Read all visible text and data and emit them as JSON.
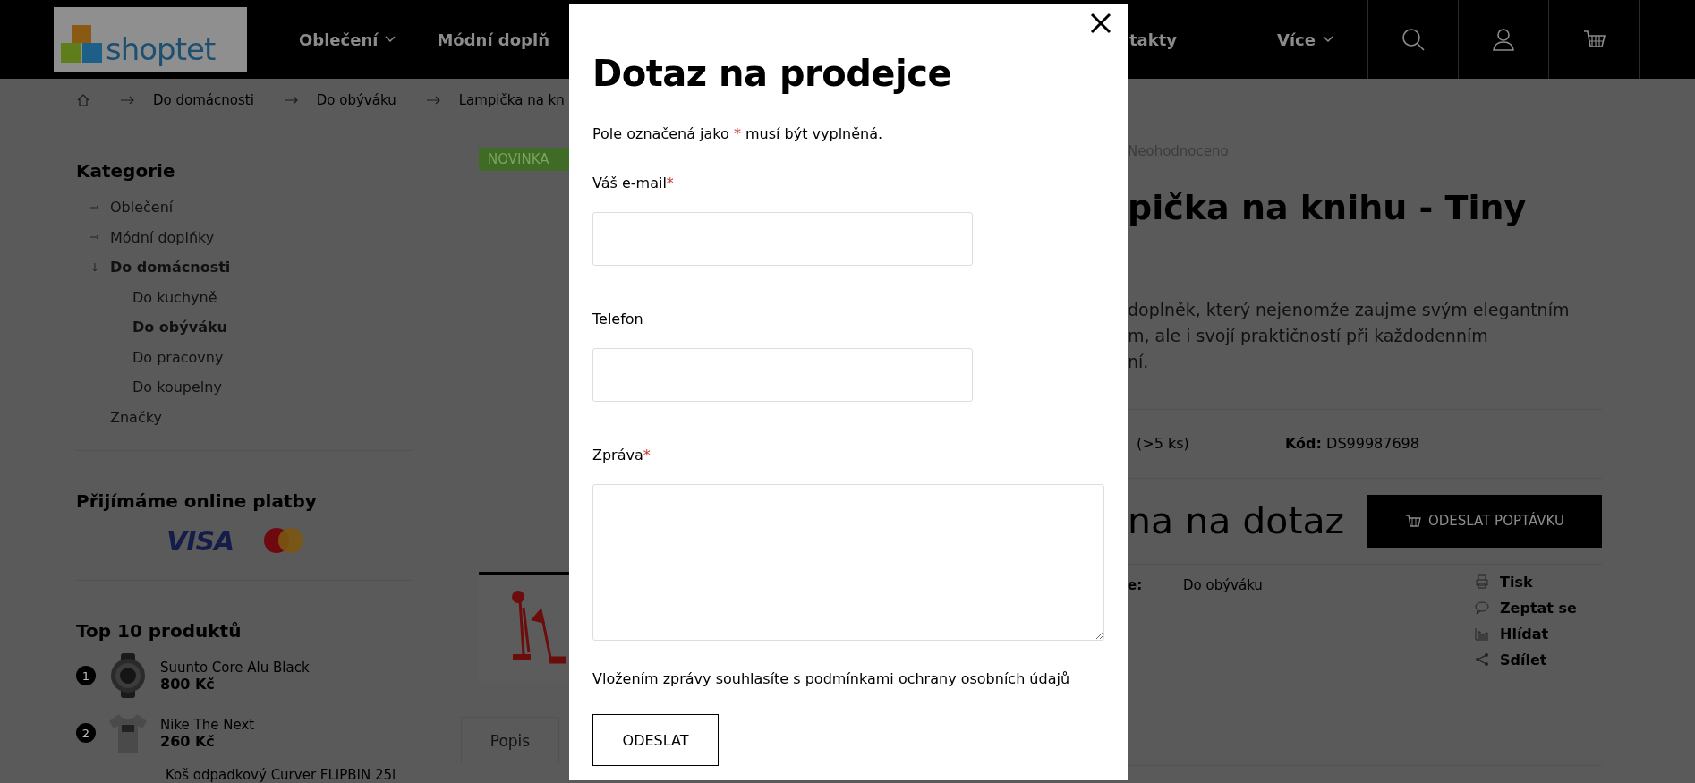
{
  "header": {
    "logo": "shoptet",
    "nav": [
      {
        "label": "Oblečení",
        "dropdown": true
      },
      {
        "label": "Módní doplň",
        "dropdown": false
      }
    ],
    "nav_right": [
      {
        "label": "takty",
        "dropdown": false
      },
      {
        "label": "Více",
        "dropdown": true
      }
    ]
  },
  "breadcrumb": [
    "Do domácnosti",
    "Do obýváku",
    "Lampička na kn"
  ],
  "sidebar": {
    "categories_title": "Kategorie",
    "categories": [
      {
        "label": "Oblečení",
        "kind": "branch",
        "expanded": false,
        "active": false
      },
      {
        "label": "Módní doplňky",
        "kind": "branch",
        "expanded": false,
        "active": false
      },
      {
        "label": "Do domácnosti",
        "kind": "branch",
        "expanded": true,
        "active": true,
        "children": [
          {
            "label": "Do kuchyně",
            "active": false
          },
          {
            "label": "Do obýváku",
            "active": true
          },
          {
            "label": "Do pracovny",
            "active": false
          },
          {
            "label": "Do koupelny",
            "active": false
          }
        ]
      },
      {
        "label": "Značky",
        "kind": "leaf",
        "active": false
      }
    ],
    "payments_title": "Přijímáme online platby",
    "payments": [
      {
        "kind": "visa",
        "label": "VISA"
      },
      {
        "kind": "mastercard"
      }
    ],
    "top_title": "Top 10 produktů",
    "top": [
      {
        "rank": "1",
        "name": "Suunto Core Alu Black",
        "price": "800 Kč",
        "kind": "watch"
      },
      {
        "rank": "2",
        "name": "Nike The Next",
        "price": "260 Kč",
        "kind": "shirt"
      },
      {
        "name": "Koš odpadkový Curver FLIPBIN 25l"
      }
    ]
  },
  "product": {
    "badge": "NOVINKA",
    "tabs": [
      "Popis"
    ],
    "rating": "Neohodnoceno",
    "title": "pička na knihu - Tiny",
    "description": [
      "doplněk, který nejenomže zaujme svým elegantním",
      "m, ale i svojí praktičností při každodenním",
      "ní."
    ],
    "stock": "(>5 ks)",
    "code_label": "Kód:",
    "code": "DS99987698",
    "price": "na na dotaz",
    "inquiry_button": "ODESLAT POPTÁVKU",
    "category_label": "e:",
    "category": "Do obýváku",
    "actions": [
      {
        "kind": "print",
        "label": "Tisk"
      },
      {
        "kind": "chat",
        "label": "Zeptat se"
      },
      {
        "kind": "chart",
        "label": "Hlídat"
      },
      {
        "kind": "share",
        "label": "Sdílet"
      }
    ]
  },
  "modal": {
    "title": "Dotaz na prodejce",
    "note_before": "Pole označená jako",
    "required_mark": "*",
    "note_after": "musí být vyplněná.",
    "fields": [
      {
        "label": "Váš e-mail",
        "required": true,
        "kind": "input"
      },
      {
        "label": "Telefon",
        "required": false,
        "kind": "input"
      },
      {
        "label": "Zpráva",
        "required": true,
        "kind": "textarea"
      }
    ],
    "consent": "Vložením zprávy souhlasíte s",
    "consent_link": "podmínkami ochrany osobních údajů",
    "submit": "ODESLAT"
  }
}
